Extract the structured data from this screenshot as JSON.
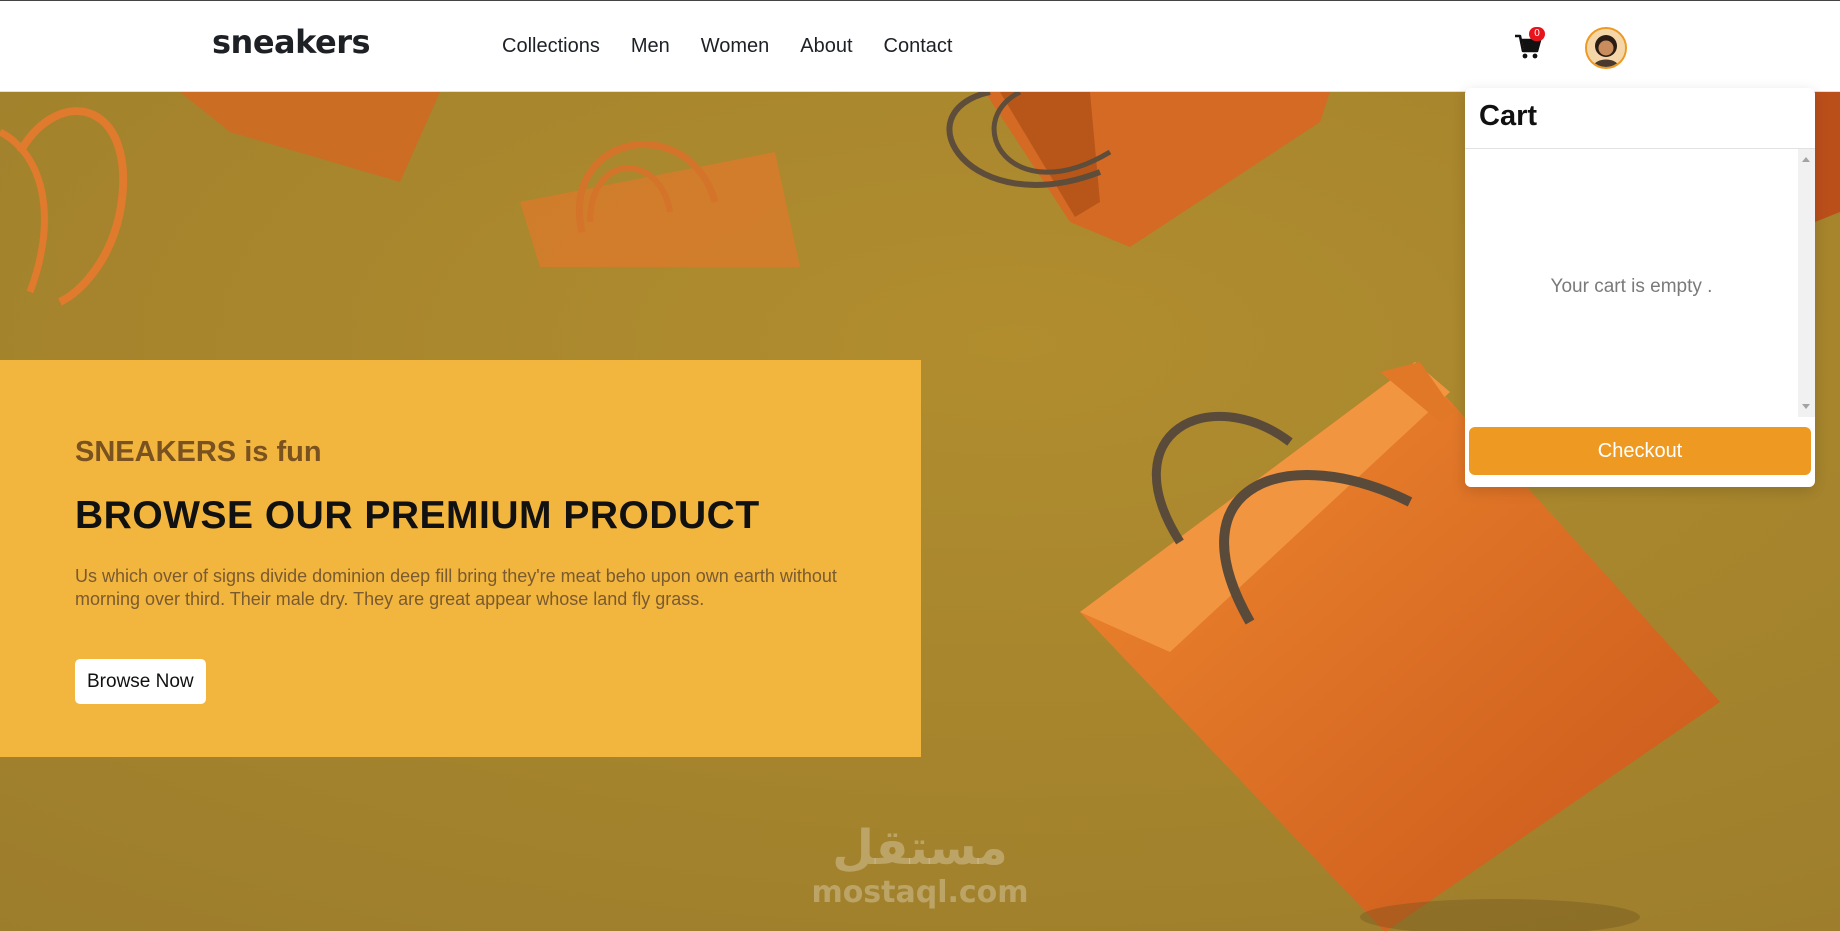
{
  "header": {
    "logo": "sneakers",
    "nav": [
      "Collections",
      "Men",
      "Women",
      "About",
      "Contact"
    ],
    "cart_count": "0"
  },
  "hero": {
    "kicker": "SNEAKERS is fun",
    "title": "BROWSE OUR PREMIUM PRODUCT",
    "description": "Us which over of signs divide dominion deep fill bring they're meat beho upon own earth without morning over third. Their male dry. They are great appear whose land fly grass.",
    "button_label": "Browse Now"
  },
  "cart": {
    "title": "Cart",
    "empty_text": "Your cart is empty .",
    "checkout_label": "Checkout"
  },
  "watermark": {
    "arabic": "مستقل",
    "latin": "mostaql.com"
  },
  "colors": {
    "accent": "#ee9a22",
    "hero_card": "#f2b53d",
    "background": "#a88a33",
    "bag": "#e87a2a",
    "badge": "#e8141c"
  },
  "icons": {
    "cart": "cart-icon",
    "avatar": "user-avatar"
  }
}
